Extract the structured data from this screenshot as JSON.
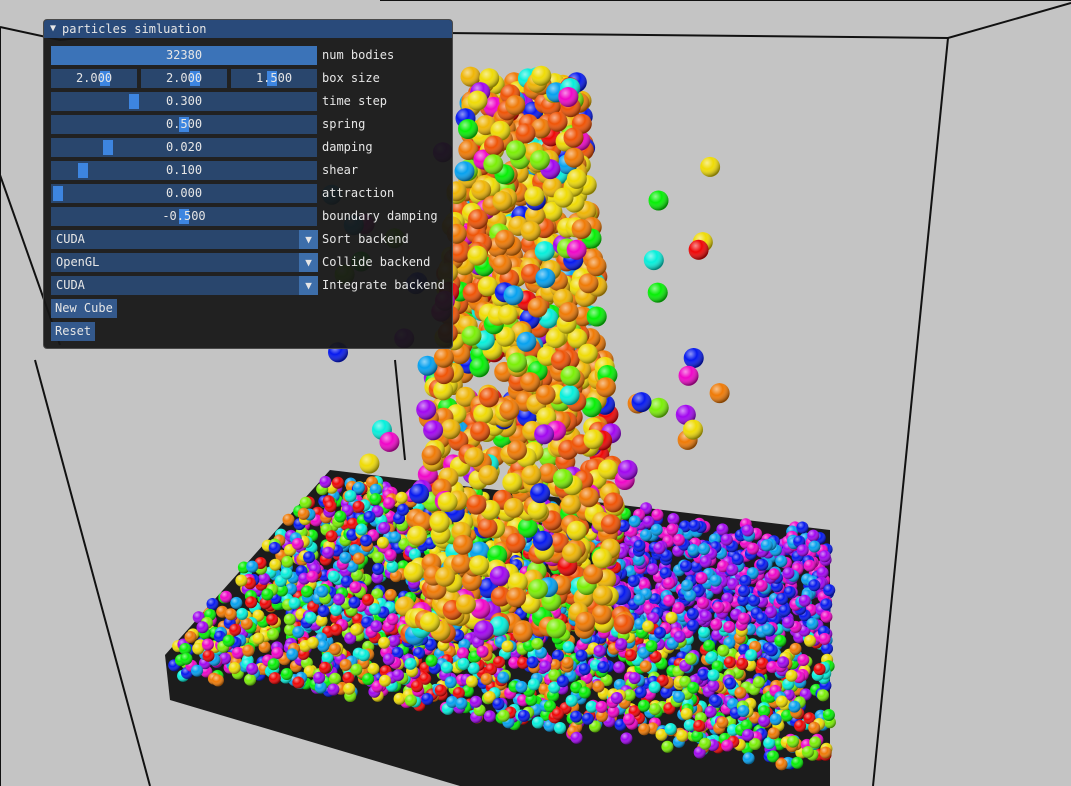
{
  "panel": {
    "title": "particles simluation",
    "num_bodies": {
      "label": "num bodies",
      "value": "32380"
    },
    "box_size": {
      "label": "box size",
      "values": [
        "2.000",
        "2.000",
        "1.500"
      ]
    },
    "time_step": {
      "label": "time step",
      "value": "0.300",
      "level": 0.3
    },
    "spring": {
      "label": "spring",
      "value": "0.500",
      "level": 0.5
    },
    "damping": {
      "label": "damping",
      "value": "0.020",
      "level": 0.2
    },
    "shear": {
      "label": "shear",
      "value": "0.100",
      "level": 0.1
    },
    "attraction": {
      "label": "attraction",
      "value": "0.000",
      "level": 0.0
    },
    "boundary_damping": {
      "label": "boundary damping",
      "value": "-0.500",
      "level": 0.5
    },
    "sort_backend": {
      "label": "Sort backend",
      "value": "CUDA"
    },
    "collide_backend": {
      "label": "Collide backend",
      "value": "OpenGL"
    },
    "integrate_backend": {
      "label": "Integrate backend",
      "value": "CUDA"
    },
    "new_cube_label": "New Cube",
    "reset_label": "Reset"
  },
  "colors": {
    "background": "#c4c4c4",
    "panel_title": "#294a7a",
    "slider_bg": "#29466d",
    "slider_grab": "#3d85e0",
    "button": "#34598c"
  }
}
